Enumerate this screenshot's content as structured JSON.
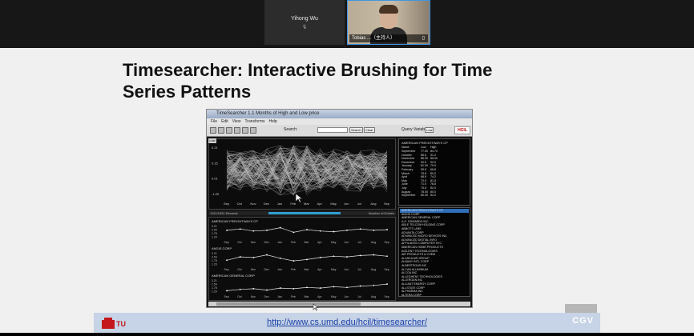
{
  "video": {
    "tile1_name": "Yihong Wu",
    "tile1_sub": "🎙",
    "tile2_label": "Tobias ...（主持人）",
    "tile2_icon": "mic-icon"
  },
  "slide": {
    "title_line1": "Timesearcher: Interactive Brushing for Time",
    "title_line2": "Series Patterns",
    "url": "http://www.cs.umd.edu/hcil/timesearcher/",
    "logo_left": "TU",
    "logo_right": "CGV"
  },
  "app": {
    "window_title": "TimeSearcher 1.1 Months of High and Low price",
    "menu": [
      "File",
      "Edit",
      "View",
      "Transforms",
      "Help"
    ],
    "search_label": "Search:",
    "search_button": "Search",
    "clear_button": "Clear",
    "query_variable_label": "Query Variable",
    "query_variable_value": "Low",
    "tab_label": "Low",
    "main_months": [
      "Sep",
      "Oct",
      "Nov",
      "Dec",
      "Jan",
      "Feb",
      "Mar",
      "Apr",
      "May",
      "Jun",
      "Jul",
      "Aug",
      "Sep"
    ],
    "main_yticks": [
      "0.21",
      "0.15",
      "0.01",
      "-1.09"
    ],
    "status_left": "1311/1931 Records",
    "status_mid": "Low",
    "status_right": "Number of Entries",
    "small_plots": [
      {
        "title": "AMERICAN FREIGHTWAYS CP",
        "yticks": [
          "3.21",
          "2.54",
          "1.78",
          "1.29"
        ]
      },
      {
        "title": "ANGIS CORP",
        "yticks": [
          "3.21",
          "2.54",
          "1.78",
          "1.29"
        ]
      },
      {
        "title": "AMERICAN GENERAL CORP",
        "yticks": [
          "3.21",
          "2.54",
          "1.78",
          "1.29"
        ]
      }
    ],
    "detail_header": "AMERICAN FREIGHTWAYS CP",
    "detail_cols": [
      "Name",
      "Low",
      "High"
    ],
    "detail_rows": [
      [
        "September",
        "77.00",
        "84.70"
      ],
      [
        "October",
        "85.5",
        "91.2"
      ],
      [
        "November",
        "86.00",
        "86.00"
      ],
      [
        "December",
        "90.5",
        "92.0"
      ],
      [
        "January",
        "81.00",
        "79.0"
      ],
      [
        "February",
        "55.8",
        "66.8"
      ],
      [
        "March",
        "78.8",
        "80.0"
      ],
      [
        "April",
        "68.9",
        "74.2"
      ],
      [
        "May",
        "70.0",
        "81.5"
      ],
      [
        "June",
        "71.0",
        "78.8"
      ],
      [
        "July",
        "75.8",
        "82.0"
      ],
      [
        "August",
        "78.00",
        "80.0"
      ],
      [
        "September",
        "80.00",
        "82.0"
      ]
    ],
    "company_list": [
      "AMERICAN FREIGHTWAYS CP",
      "ANGIS CORP",
      "AMERICAN GENERAL CORP",
      "A.G. EDWARDS INC",
      "ABLE TELCOM HOLDING CORP",
      "ABBOTT LABS",
      "ADVANTA CORP",
      "ADVANCED MICRO DEVICES INC",
      "ADVANCED DIGITAL INFO",
      "AFFILIATED COMPUTER SVC",
      "AMERICAN HOME PRODUCTS",
      "AGILENT TECHNOLOGIES",
      "AIR PRODUCTS & CHEM",
      "ALASKA AIR GROUP",
      "ALBANY INTL CORP",
      "ALBERTSONS INC",
      "ALCAN ALUMINIUM",
      "ALCOA INC",
      "ALLEGHENY TECHNOLOGIES",
      "ALLERGAN INC",
      "ALLIANT ENERGY CORP",
      "ALLSTATE CORP",
      "ALPHARMA INC",
      "ALTERA CORP"
    ]
  },
  "chart_data": [
    {
      "type": "line",
      "x": [
        "Sep",
        "Oct",
        "Nov",
        "Dec",
        "Jan",
        "Feb",
        "Mar",
        "Apr",
        "May",
        "Jun",
        "Jul",
        "Aug",
        "Sep"
      ],
      "series": [
        {
          "values": [
            2.5,
            2.7,
            2.4,
            2.5,
            2.9,
            2.2,
            2.6,
            2.4,
            2.3,
            2.5,
            2.7,
            2.5,
            2.6
          ]
        }
      ],
      "ylim": [
        1.29,
        3.21
      ]
    },
    {
      "type": "line",
      "x": [
        "Sep",
        "Oct",
        "Nov",
        "Dec",
        "Jan",
        "Feb",
        "Mar",
        "Apr",
        "May",
        "Jun",
        "Jul",
        "Aug",
        "Sep"
      ],
      "series": [
        {
          "values": [
            2.1,
            2.6,
            2.5,
            2.9,
            2.4,
            2.0,
            2.2,
            2.5,
            2.7,
            2.6,
            2.8,
            2.9,
            2.7
          ]
        }
      ],
      "ylim": [
        1.29,
        3.21
      ]
    },
    {
      "type": "line",
      "x": [
        "Sep",
        "Oct",
        "Nov",
        "Dec",
        "Jan",
        "Feb",
        "Mar",
        "Apr",
        "May",
        "Jun",
        "Jul",
        "Aug",
        "Sep"
      ],
      "series": [
        {
          "values": [
            1.6,
            1.8,
            1.9,
            1.7,
            2.0,
            1.9,
            2.1,
            2.0,
            2.2,
            2.1,
            2.3,
            2.4,
            2.6
          ]
        }
      ],
      "ylim": [
        1.29,
        3.21
      ]
    }
  ]
}
